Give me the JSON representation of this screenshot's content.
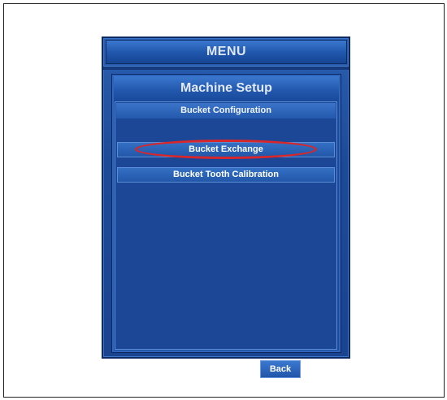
{
  "header": {
    "title": "MENU"
  },
  "panel": {
    "title": "Machine Setup",
    "section_heading": "Bucket Configuration",
    "items": [
      {
        "label": "Bucket Exchange",
        "highlighted": true
      },
      {
        "label": "Bucket Tooth Calibration",
        "highlighted": false
      }
    ],
    "back_label": "Back"
  },
  "colors": {
    "panel_blue": "#1b4899",
    "highlight_red": "#d9262b"
  }
}
